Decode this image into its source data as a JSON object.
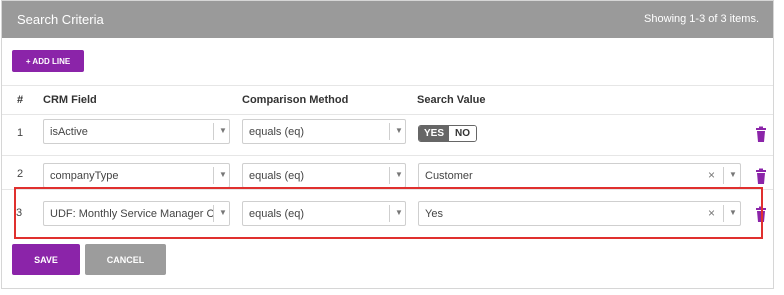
{
  "header": {
    "title": "Search Criteria",
    "count": "Showing 1-3 of 3 items."
  },
  "toolbar": {
    "add_line_label": "+ ADD LINE"
  },
  "columns": {
    "num": "#",
    "crm_field": "CRM Field",
    "comparison": "Comparison Method",
    "search_value": "Search Value"
  },
  "rows": [
    {
      "num": "1",
      "field": "isActive",
      "method": "equals (eq)",
      "toggle": {
        "yes": "YES",
        "no": "NO",
        "selected": "YES"
      }
    },
    {
      "num": "2",
      "field": "companyType",
      "method": "equals (eq)",
      "value": "Customer"
    },
    {
      "num": "3",
      "field": "UDF: Monthly Service Manager Call",
      "method": "equals (eq)",
      "value": "Yes"
    }
  ],
  "icons": {
    "dropdown": "chevron-down-icon",
    "clear": "clear-icon",
    "delete": "trash-icon"
  },
  "actions": {
    "save_label": "SAVE",
    "cancel_label": "CANCEL"
  },
  "colors": {
    "accent": "#8b24a9",
    "header_bg": "#9a9a9a",
    "cancel_bg": "#9c9c9c",
    "highlight": "#e0302e"
  }
}
